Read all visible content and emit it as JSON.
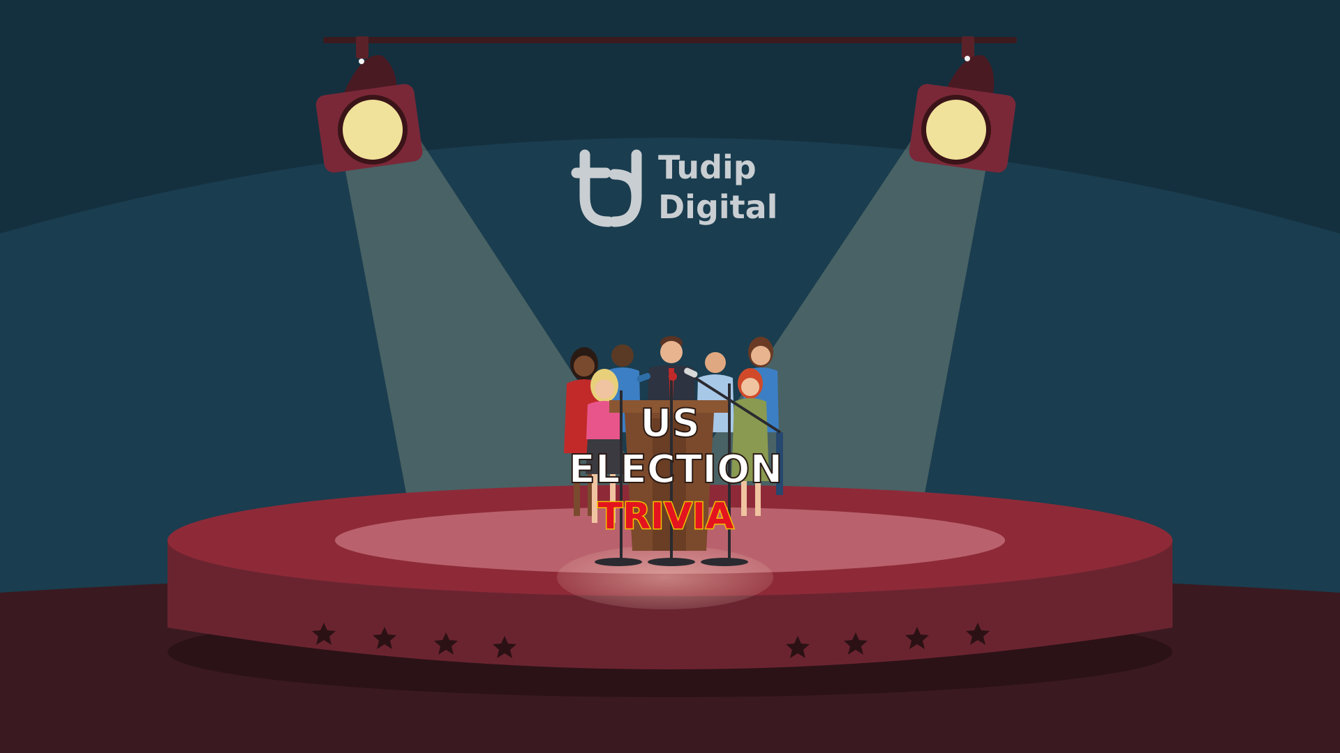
{
  "logo": {
    "line1": "Tudip",
    "line2": "Digital"
  },
  "title": {
    "line1": "US",
    "line2": "ELECTION",
    "line3": "TRIVIA"
  },
  "colors": {
    "sky_top": "#14303f",
    "backdrop": "#1a3d4f",
    "floor": "#3a1a20",
    "stage_top": "#8e2a38",
    "stage_side": "#6a2430",
    "spotlight_housing": "#7a2838",
    "spotlight_bulb": "#f0e29a",
    "beam": "#f3e7b5",
    "logo": "#c9ced2",
    "title_white": "#ffffff",
    "title_red": "#e3141f",
    "title_outline": "#f2c200",
    "podium": "#7b4a2c",
    "star": "#2b1114"
  },
  "icons": {
    "spotlight_left": "spotlight-icon",
    "spotlight_right": "spotlight-icon",
    "logo_mark": "tudip-logo-icon",
    "star": "star-icon",
    "microphone": "microphone-icon"
  }
}
